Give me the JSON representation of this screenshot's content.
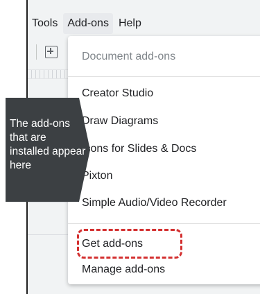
{
  "menubar": {
    "items": [
      {
        "label": "Tools"
      },
      {
        "label": "Add-ons"
      },
      {
        "label": "Help"
      }
    ]
  },
  "dropdown": {
    "header": "Document add-ons",
    "installed": [
      {
        "label": "Creator Studio"
      },
      {
        "label": "Draw Diagrams"
      },
      {
        "label": "Icons for Slides & Docs"
      },
      {
        "label": "Pixton"
      },
      {
        "label": "Simple Audio/Video Recorder"
      }
    ],
    "get_addons": "Get add-ons",
    "manage_addons": "Manage add-ons"
  },
  "callout": {
    "text": "The add-ons that are installed appear here",
    "color": "#3c4043"
  },
  "highlight": {
    "color": "#d32f2f"
  },
  "toolbar": {
    "icon": "add-comment-icon"
  }
}
